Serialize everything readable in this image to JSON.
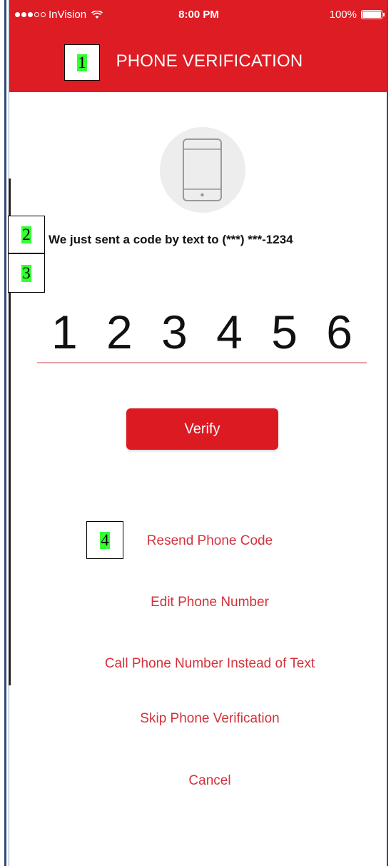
{
  "status_bar": {
    "carrier": "InVision",
    "time": "8:00 PM",
    "battery": "100%"
  },
  "header": {
    "title": "PHONE VERIFICATION"
  },
  "callouts": [
    "1",
    "2",
    "3",
    "4"
  ],
  "message": "We just sent a code by text to (***) ***-1234",
  "code_digits": [
    "1",
    "2",
    "3",
    "4",
    "5",
    "6"
  ],
  "verify_label": "Verify",
  "links": {
    "resend": "Resend Phone Code",
    "edit": "Edit Phone Number",
    "call": "Call Phone Number Instead of Text",
    "skip": "Skip Phone Verification",
    "cancel": "Cancel"
  },
  "colors": {
    "brand_red": "#de1c24",
    "link_red": "#d3323a",
    "callout_highlight": "#33ff33"
  }
}
